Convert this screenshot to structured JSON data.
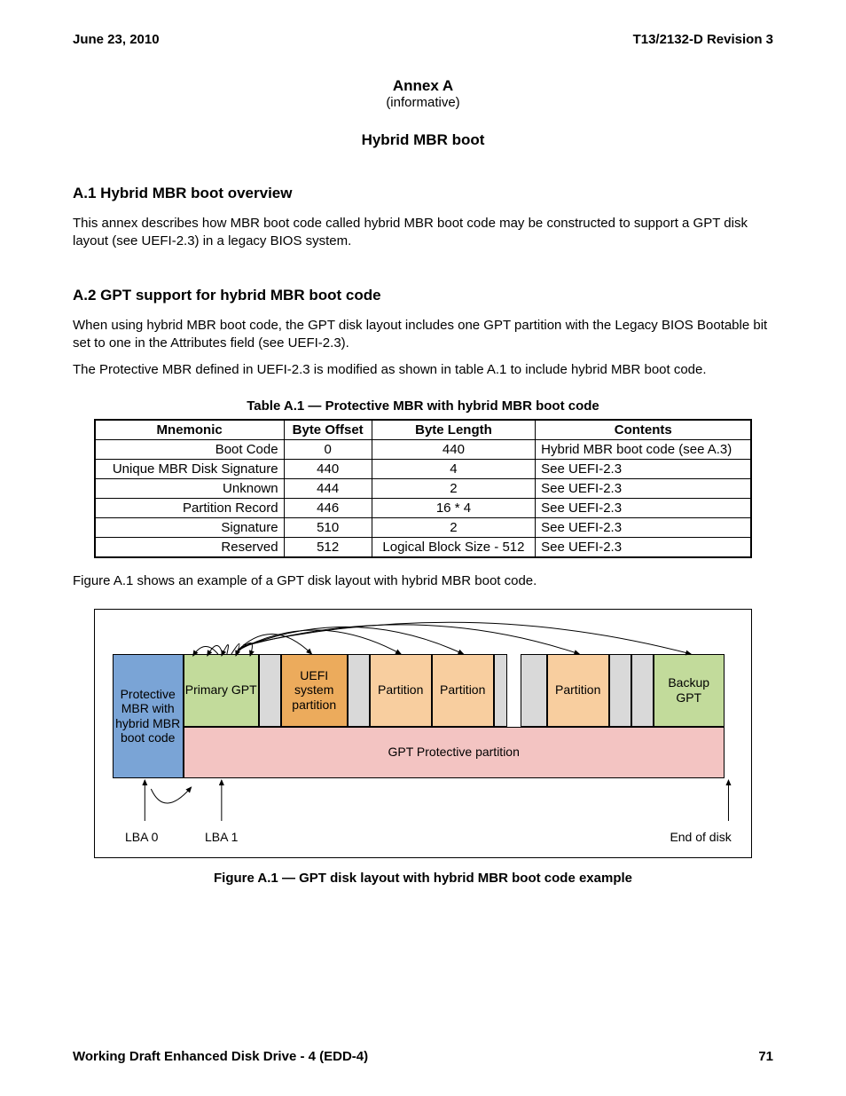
{
  "header": {
    "left": "June 23, 2010",
    "right": "T13/2132-D Revision 3"
  },
  "annex": {
    "title": "Annex A",
    "informative": "(informative)",
    "subtitle": "Hybrid MBR boot"
  },
  "sections": {
    "a1": {
      "heading": "A.1 Hybrid MBR boot overview",
      "p1": "This annex describes how MBR boot code called hybrid MBR boot code may be constructed to support a GPT disk layout (see UEFI-2.3) in a legacy BIOS system."
    },
    "a2": {
      "heading": "A.2 GPT support for hybrid MBR boot code",
      "p1": "When using hybrid MBR boot code, the GPT disk layout includes one GPT partition with the Legacy BIOS Bootable bit set to one in the Attributes field (see UEFI-2.3).",
      "p2": "The Protective MBR defined in UEFI-2.3 is modified as shown in table A.1 to include hybrid MBR boot code.",
      "p3": "Figure A.1 shows an example of a GPT disk layout with hybrid MBR boot code."
    }
  },
  "table": {
    "caption": "Table A.1 — Protective MBR with hybrid MBR boot code",
    "headers": [
      "Mnemonic",
      "Byte Offset",
      "Byte Length",
      "Contents"
    ],
    "rows": [
      [
        "Boot Code",
        "0",
        "440",
        "Hybrid MBR boot code (see A.3)"
      ],
      [
        "Unique MBR Disk Signature",
        "440",
        "4",
        "See UEFI-2.3"
      ],
      [
        "Unknown",
        "444",
        "2",
        "See UEFI-2.3"
      ],
      [
        "Partition Record",
        "446",
        "16 * 4",
        "See UEFI-2.3"
      ],
      [
        "Signature",
        "510",
        "2",
        "See UEFI-2.3"
      ],
      [
        "Reserved",
        "512",
        "Logical Block Size - 512",
        "See UEFI-2.3"
      ]
    ]
  },
  "figure": {
    "caption": "Figure A.1 — GPT disk layout with hybrid MBR boot code example",
    "blocks": {
      "mbr": "Protective MBR with hybrid MBR boot code",
      "primary_gpt": "Primary GPT",
      "uefi": "UEFI system partition",
      "partition": "Partition",
      "backup_gpt": "Backup GPT",
      "protective": "GPT Protective partition"
    },
    "labels": {
      "lba0": "LBA 0",
      "lba1": "LBA 1",
      "end": "End of disk"
    }
  },
  "footer": {
    "left": "Working Draft Enhanced Disk Drive - 4  (EDD-4)",
    "right": "71"
  }
}
